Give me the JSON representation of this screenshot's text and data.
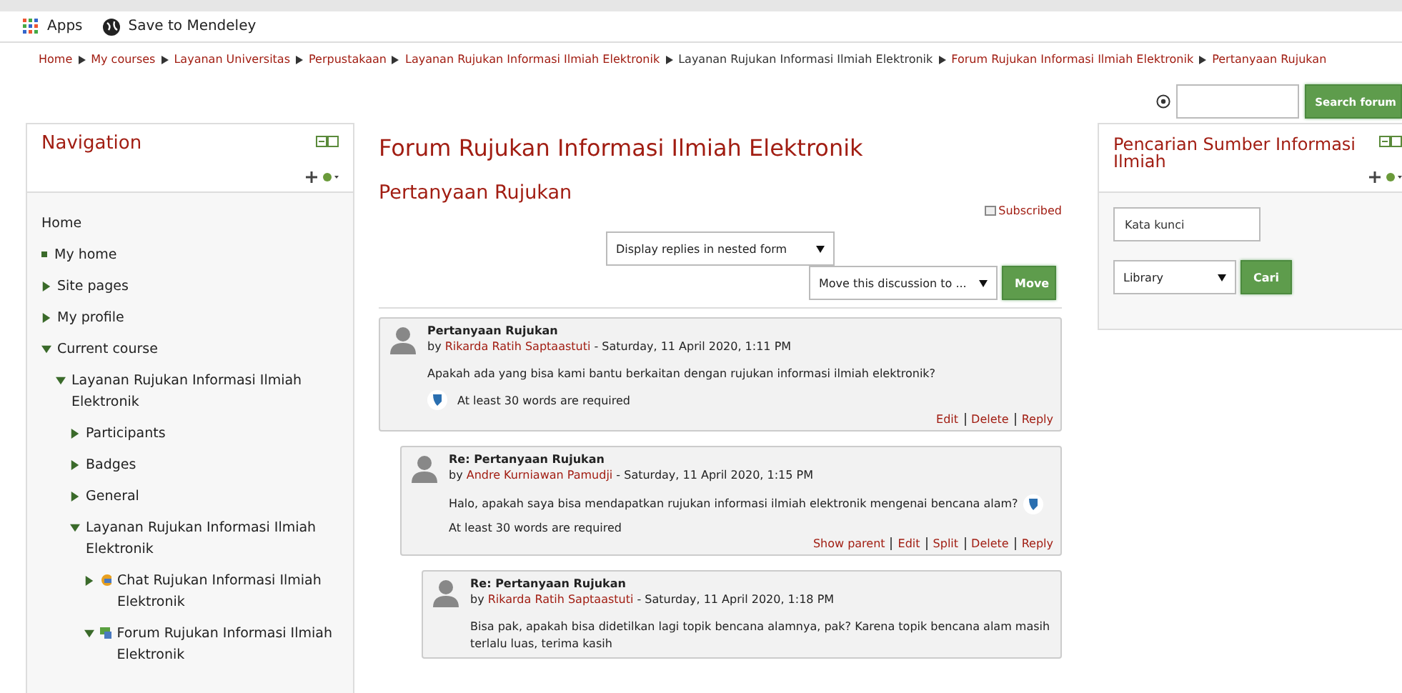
{
  "bookmarks": [
    {
      "kind": "apps",
      "label": "Apps"
    },
    {
      "kind": "globe",
      "label": "Save to Mendeley"
    }
  ],
  "breadcrumb": [
    {
      "label": "Home",
      "link": true
    },
    {
      "label": "My courses",
      "link": true
    },
    {
      "label": "Layanan Universitas",
      "link": true
    },
    {
      "label": "Perpustakaan",
      "link": true
    },
    {
      "label": "Layanan Rujukan Informasi Ilmiah Elektronik",
      "link": true
    },
    {
      "label": "Layanan Rujukan Informasi Ilmiah Elektronik",
      "link": false
    },
    {
      "label": "Forum Rujukan Informasi Ilmiah Elektronik",
      "link": true
    },
    {
      "label": "Pertanyaan Rujukan",
      "link": true
    }
  ],
  "forum_search": {
    "button": "Search forum"
  },
  "navigation": {
    "title": "Navigation",
    "items": [
      {
        "label": "Home",
        "kind": "plain"
      },
      {
        "label": "My home",
        "kind": "leaf"
      },
      {
        "label": "Site pages",
        "kind": "branch",
        "expanded": false
      },
      {
        "label": "My profile",
        "kind": "branch",
        "expanded": false
      },
      {
        "label": "Current course",
        "kind": "branch",
        "expanded": true,
        "children": [
          {
            "label": "Layanan Rujukan Informasi Ilmiah Elektronik",
            "kind": "branch",
            "expanded": true,
            "children": [
              {
                "label": "Participants",
                "kind": "branch",
                "expanded": false
              },
              {
                "label": "Badges",
                "kind": "branch",
                "expanded": false
              },
              {
                "label": "General",
                "kind": "branch",
                "expanded": false
              },
              {
                "label": "Layanan Rujukan Informasi Ilmiah Elektronik",
                "kind": "branch",
                "expanded": true,
                "children": [
                  {
                    "label": "Chat Rujukan Informasi Ilmiah Elektronik",
                    "kind": "chat",
                    "expanded": false
                  },
                  {
                    "label": "Forum Rujukan Informasi Ilmiah Elektronik",
                    "kind": "forum",
                    "expanded": true
                  }
                ]
              }
            ]
          }
        ]
      }
    ]
  },
  "main": {
    "title": "Forum Rujukan Informasi Ilmiah Elektronik",
    "subtitle": "Pertanyaan Rujukan",
    "subscribed": "Subscribed",
    "display_select": "Display replies in nested form",
    "move_select": "Move this discussion to ...",
    "move_button": "Move",
    "posts": [
      {
        "subject": "Pertanyaan Rujukan",
        "author": "Rikarda Ratih Saptaastuti",
        "by": "by",
        "date": " - Saturday, 11 April 2020, 1:11 PM",
        "message": "Apakah ada yang bisa kami bantu berkaitan dengan rujukan informasi ilmiah elektronik?",
        "notice": "At least 30 words are required",
        "notice_inline": false,
        "actions": [
          "Edit",
          "Delete",
          "Reply"
        ],
        "children": [
          {
            "subject": "Re: Pertanyaan Rujukan",
            "author": "Andre Kurniawan Pamudji",
            "by": "by",
            "date": " - Saturday, 11 April 2020, 1:15 PM",
            "message": "Halo, apakah saya bisa mendapatkan rujukan informasi ilmiah elektronik mengenai bencana alam?",
            "notice": "At least 30 words are required",
            "notice_inline": true,
            "actions": [
              "Show parent",
              "Edit",
              "Split",
              "Delete",
              "Reply"
            ],
            "children": [
              {
                "subject": "Re: Pertanyaan Rujukan",
                "author": "Rikarda Ratih Saptaastuti",
                "by": "by",
                "date": " - Saturday, 11 April 2020, 1:18 PM",
                "message": "Bisa pak, apakah bisa didetilkan lagi topik bencana alamnya, pak? Karena topik bencana alam masih terlalu luas, terima kasih"
              }
            ]
          }
        ]
      }
    ]
  },
  "side_block": {
    "title": "Pencarian Sumber Informasi Ilmiah",
    "keyword_placeholder": "Kata kunci",
    "select": "Library",
    "button": "Cari"
  }
}
